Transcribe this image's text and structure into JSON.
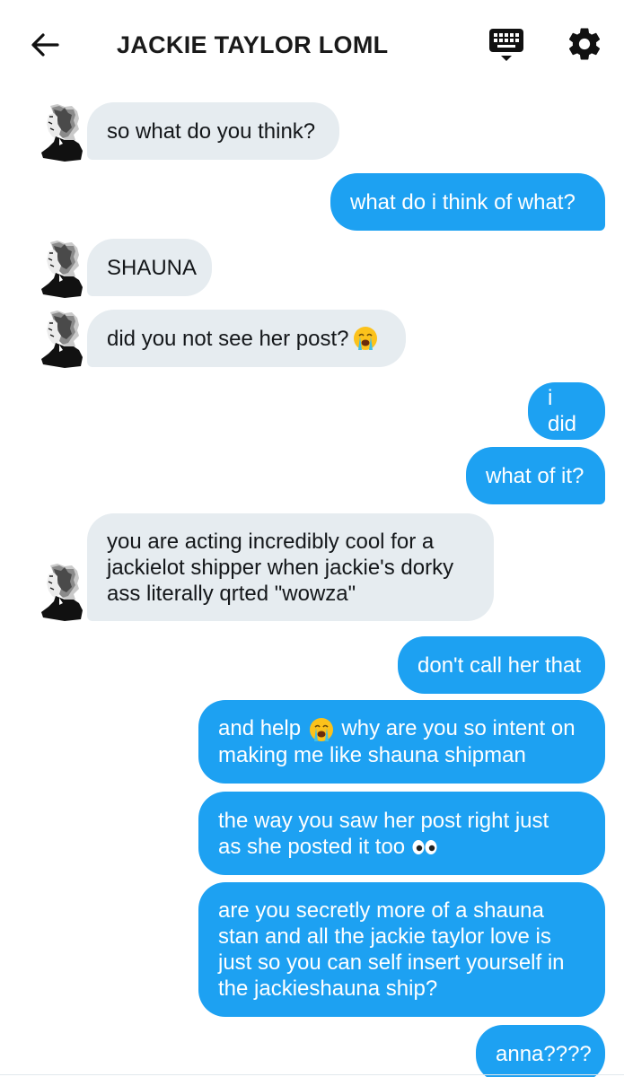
{
  "header": {
    "title": "JACKIE TAYLOR LOML",
    "back_icon": "arrow-left-icon",
    "keyboard_icon": "keyboard-icon",
    "settings_icon": "gear-icon"
  },
  "colors": {
    "outgoing_bubble": "#1da1f2",
    "incoming_bubble": "#e6ecf0"
  },
  "messages": [
    {
      "direction": "in",
      "text": "so what do you think?"
    },
    {
      "direction": "out",
      "text": "what do i think of what?"
    },
    {
      "direction": "in",
      "text": "SHAUNA"
    },
    {
      "direction": "in",
      "text": "did you not see her post? ",
      "emoji": "loudly-crying-face"
    },
    {
      "direction": "out",
      "text": "i did"
    },
    {
      "direction": "out",
      "text": "what of it?"
    },
    {
      "direction": "in",
      "text": "you are acting incredibly cool for a\njackielot shipper when jackie's dorky\nass literally qrted \"wowza\""
    },
    {
      "direction": "out",
      "text": "don't call her that"
    },
    {
      "direction": "out",
      "text_a": "and help ",
      "emoji": "loudly-crying-face",
      "text_b": " why are you so intent on\nmaking me like shauna shipman"
    },
    {
      "direction": "out",
      "text": "the way you saw her post right just\nas she posted it too ",
      "emoji": "eyes"
    },
    {
      "direction": "out",
      "text": "are you secretly more of a shauna\nstan and all the jackie taylor love is\njust so you can self insert yourself in\nthe jackieshauna ship?"
    },
    {
      "direction": "out",
      "text": "anna????"
    }
  ]
}
